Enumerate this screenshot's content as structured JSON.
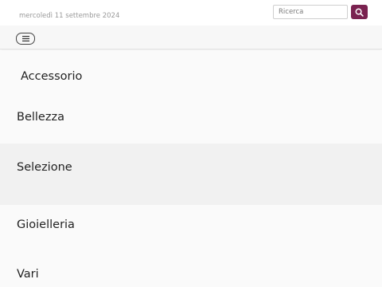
{
  "header": {
    "date": "mercoledì 11 settembre 2024",
    "search": {
      "placeholder": "Ricerca",
      "value": ""
    },
    "accent_color": "#7a2250"
  },
  "navbar": {
    "menu_toggle_icon": "hamburger-icon"
  },
  "menu": {
    "items": [
      {
        "label": "Accessorio"
      },
      {
        "label": "Bellezza"
      },
      {
        "label": "Selezione",
        "highlighted": true
      },
      {
        "label": "Gioielleria"
      },
      {
        "label": "Vari"
      }
    ]
  }
}
